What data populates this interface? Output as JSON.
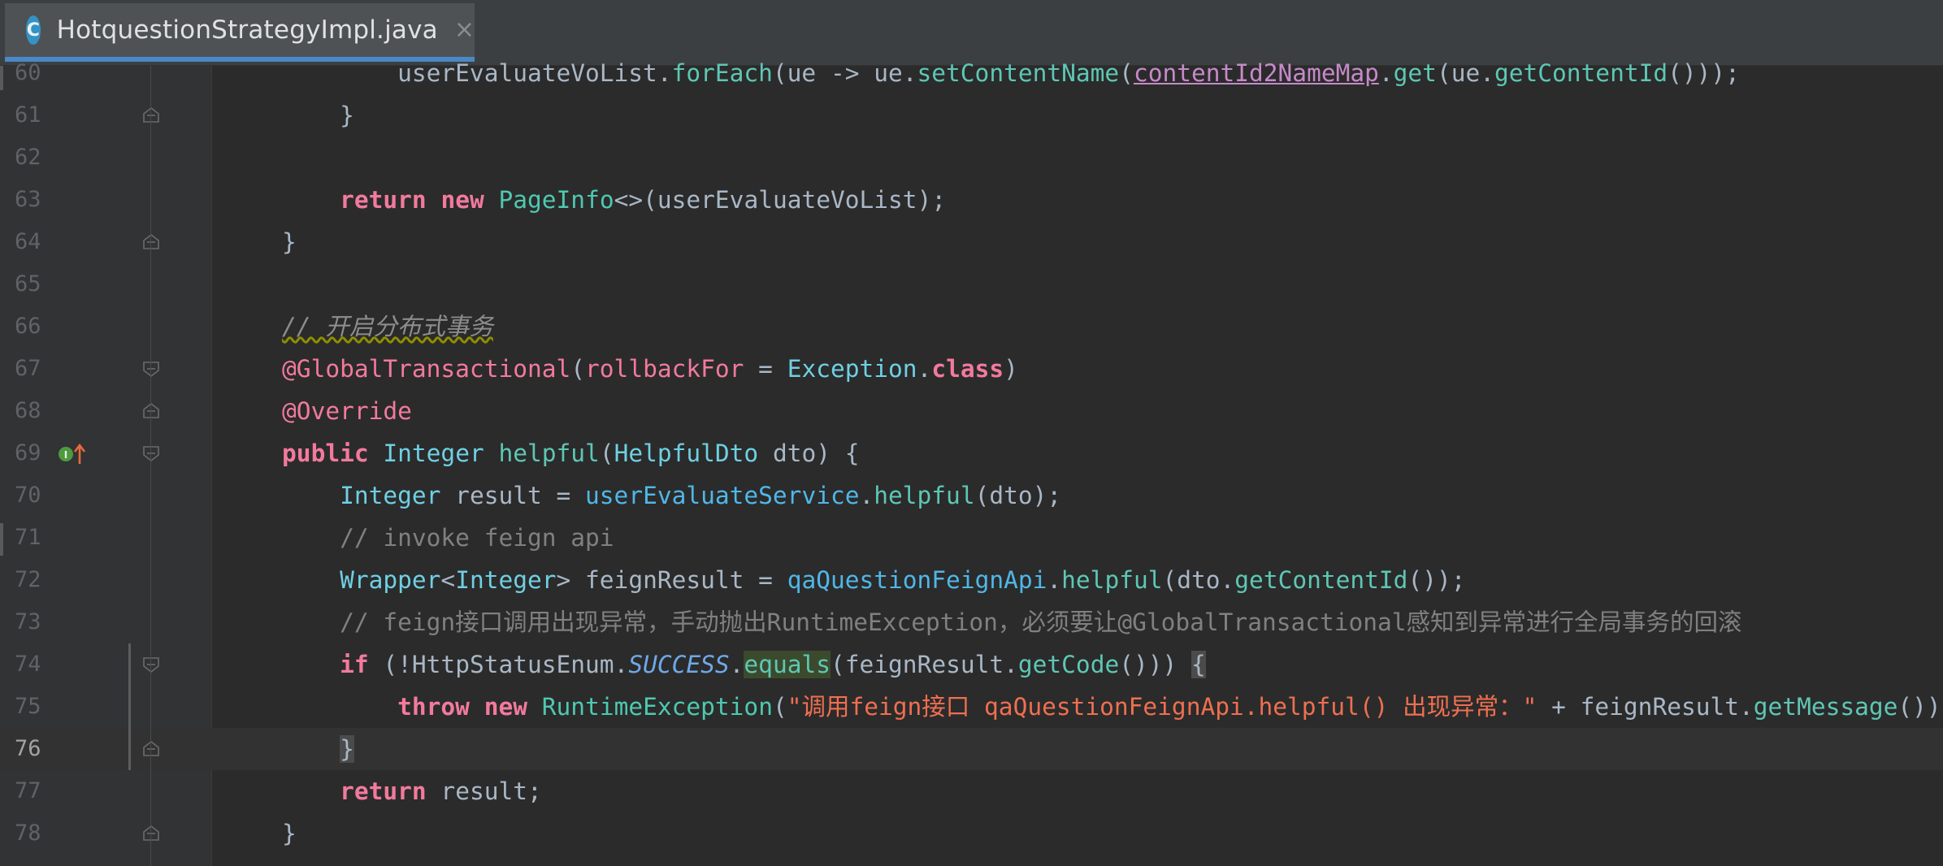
{
  "tab": {
    "icon_letter": "C",
    "title": "HotquestionStrategyImpl.java",
    "close_glyph": "×"
  },
  "editor": {
    "lines": [
      {
        "num": "60",
        "tokens": [
          {
            "t": "            userEvaluateVoList.",
            "c": ""
          },
          {
            "t": "forEach",
            "c": "mc"
          },
          {
            "t": "(ue -> ue.",
            "c": ""
          },
          {
            "t": "setContentName",
            "c": "mc"
          },
          {
            "t": "(",
            "c": ""
          },
          {
            "t": "contentId2NameMap",
            "c": "tf"
          },
          {
            "t": ".",
            "c": ""
          },
          {
            "t": "get",
            "c": "mc"
          },
          {
            "t": "(ue.",
            "c": ""
          },
          {
            "t": "getContentId",
            "c": "mc"
          },
          {
            "t": "()));",
            "c": ""
          }
        ]
      },
      {
        "num": "61",
        "tokens": [
          {
            "t": "        }",
            "c": ""
          }
        ]
      },
      {
        "num": "62",
        "tokens": []
      },
      {
        "num": "63",
        "tokens": [
          {
            "t": "        ",
            "c": ""
          },
          {
            "t": "return",
            "c": "kwp"
          },
          {
            "t": " ",
            "c": ""
          },
          {
            "t": "new",
            "c": "kwp"
          },
          {
            "t": " ",
            "c": ""
          },
          {
            "t": "PageInfo",
            "c": "fn"
          },
          {
            "t": "<>(userEvaluateVoList);",
            "c": ""
          }
        ]
      },
      {
        "num": "64",
        "tokens": [
          {
            "t": "    }",
            "c": ""
          }
        ]
      },
      {
        "num": "65",
        "tokens": []
      },
      {
        "num": "66",
        "tokens": [
          {
            "t": "    ",
            "c": ""
          },
          {
            "t": "// 开启分布式事务",
            "c": "cmtz sq-under"
          }
        ]
      },
      {
        "num": "67",
        "tokens": [
          {
            "t": "    ",
            "c": ""
          },
          {
            "t": "@GlobalTransactional",
            "c": "ann"
          },
          {
            "t": "(",
            "c": ""
          },
          {
            "t": "rollbackFor",
            "c": "ann"
          },
          {
            "t": " = ",
            "c": ""
          },
          {
            "t": "Exception",
            "c": "ty"
          },
          {
            "t": ".",
            "c": ""
          },
          {
            "t": "class",
            "c": "kwp"
          },
          {
            "t": ")",
            "c": ""
          }
        ]
      },
      {
        "num": "68",
        "tokens": [
          {
            "t": "    ",
            "c": ""
          },
          {
            "t": "@Override",
            "c": "ann"
          }
        ]
      },
      {
        "num": "69",
        "tokens": [
          {
            "t": "    ",
            "c": ""
          },
          {
            "t": "public",
            "c": "kwp"
          },
          {
            "t": " ",
            "c": ""
          },
          {
            "t": "Integer",
            "c": "ty"
          },
          {
            "t": " ",
            "c": ""
          },
          {
            "t": "helpful",
            "c": "mc"
          },
          {
            "t": "(",
            "c": ""
          },
          {
            "t": "HelpfulDto",
            "c": "ty"
          },
          {
            "t": " dto) {",
            "c": ""
          }
        ]
      },
      {
        "num": "70",
        "tokens": [
          {
            "t": "        ",
            "c": ""
          },
          {
            "t": "Integer",
            "c": "ty"
          },
          {
            "t": " result = ",
            "c": ""
          },
          {
            "t": "userEvaluateService",
            "c": "fld"
          },
          {
            "t": ".",
            "c": ""
          },
          {
            "t": "helpful",
            "c": "mc"
          },
          {
            "t": "(dto);",
            "c": ""
          }
        ]
      },
      {
        "num": "71",
        "tokens": [
          {
            "t": "        ",
            "c": ""
          },
          {
            "t": "// invoke feign api",
            "c": "cmt"
          }
        ]
      },
      {
        "num": "72",
        "tokens": [
          {
            "t": "        ",
            "c": ""
          },
          {
            "t": "Wrapper",
            "c": "ty"
          },
          {
            "t": "<",
            "c": ""
          },
          {
            "t": "Integer",
            "c": "ty"
          },
          {
            "t": "> feignResult = ",
            "c": ""
          },
          {
            "t": "qaQuestionFeignApi",
            "c": "fld"
          },
          {
            "t": ".",
            "c": ""
          },
          {
            "t": "helpful",
            "c": "mc"
          },
          {
            "t": "(dto.",
            "c": ""
          },
          {
            "t": "getContentId",
            "c": "mc"
          },
          {
            "t": "());",
            "c": ""
          }
        ]
      },
      {
        "num": "73",
        "tokens": [
          {
            "t": "        ",
            "c": ""
          },
          {
            "t": "// feign接口调用出现异常，手动抛出RuntimeException，必须要让@GlobalTransactional感知到异常进行全局事务的回滚",
            "c": "cmt"
          }
        ]
      },
      {
        "num": "74",
        "tokens": [
          {
            "t": "        ",
            "c": ""
          },
          {
            "t": "if",
            "c": "kwp"
          },
          {
            "t": " (!HttpStatusEnum.",
            "c": ""
          },
          {
            "t": "SUCCESS",
            "c": "cst"
          },
          {
            "t": ".",
            "c": ""
          },
          {
            "t": "equals",
            "c": "mc hl-eq"
          },
          {
            "t": "(feignResult.",
            "c": ""
          },
          {
            "t": "getCode",
            "c": "mc"
          },
          {
            "t": "())) ",
            "c": ""
          },
          {
            "t": "{",
            "c": "hl-brace"
          }
        ]
      },
      {
        "num": "75",
        "tokens": [
          {
            "t": "            ",
            "c": ""
          },
          {
            "t": "throw",
            "c": "kwp"
          },
          {
            "t": " ",
            "c": ""
          },
          {
            "t": "new",
            "c": "kwp"
          },
          {
            "t": " ",
            "c": ""
          },
          {
            "t": "RuntimeException",
            "c": "fn"
          },
          {
            "t": "(",
            "c": ""
          },
          {
            "t": "\"调用feign接口 qaQuestionFeignApi.helpful() 出现异常：\"",
            "c": "str"
          },
          {
            "t": " + feignResult.",
            "c": ""
          },
          {
            "t": "getMessage",
            "c": "mc"
          },
          {
            "t": "());",
            "c": ""
          }
        ]
      },
      {
        "num": "76",
        "tokens": [
          {
            "t": "        ",
            "c": ""
          },
          {
            "t": "}",
            "c": "hl-brace"
          }
        ],
        "current": true
      },
      {
        "num": "77",
        "tokens": [
          {
            "t": "        ",
            "c": ""
          },
          {
            "t": "return",
            "c": "kwp"
          },
          {
            "t": " result;",
            "c": ""
          }
        ]
      },
      {
        "num": "78",
        "tokens": [
          {
            "t": "    }",
            "c": ""
          }
        ]
      }
    ]
  },
  "colors": {
    "background": "#2b2b2b",
    "gutter": "#313335",
    "tabbar": "#3c3f41",
    "accent": "#4a88c7"
  },
  "icons": {
    "tab": "java-class-icon",
    "close": "close-icon",
    "implements": "implements-up-arrow-icon",
    "fold": "fold-marker-icon"
  }
}
